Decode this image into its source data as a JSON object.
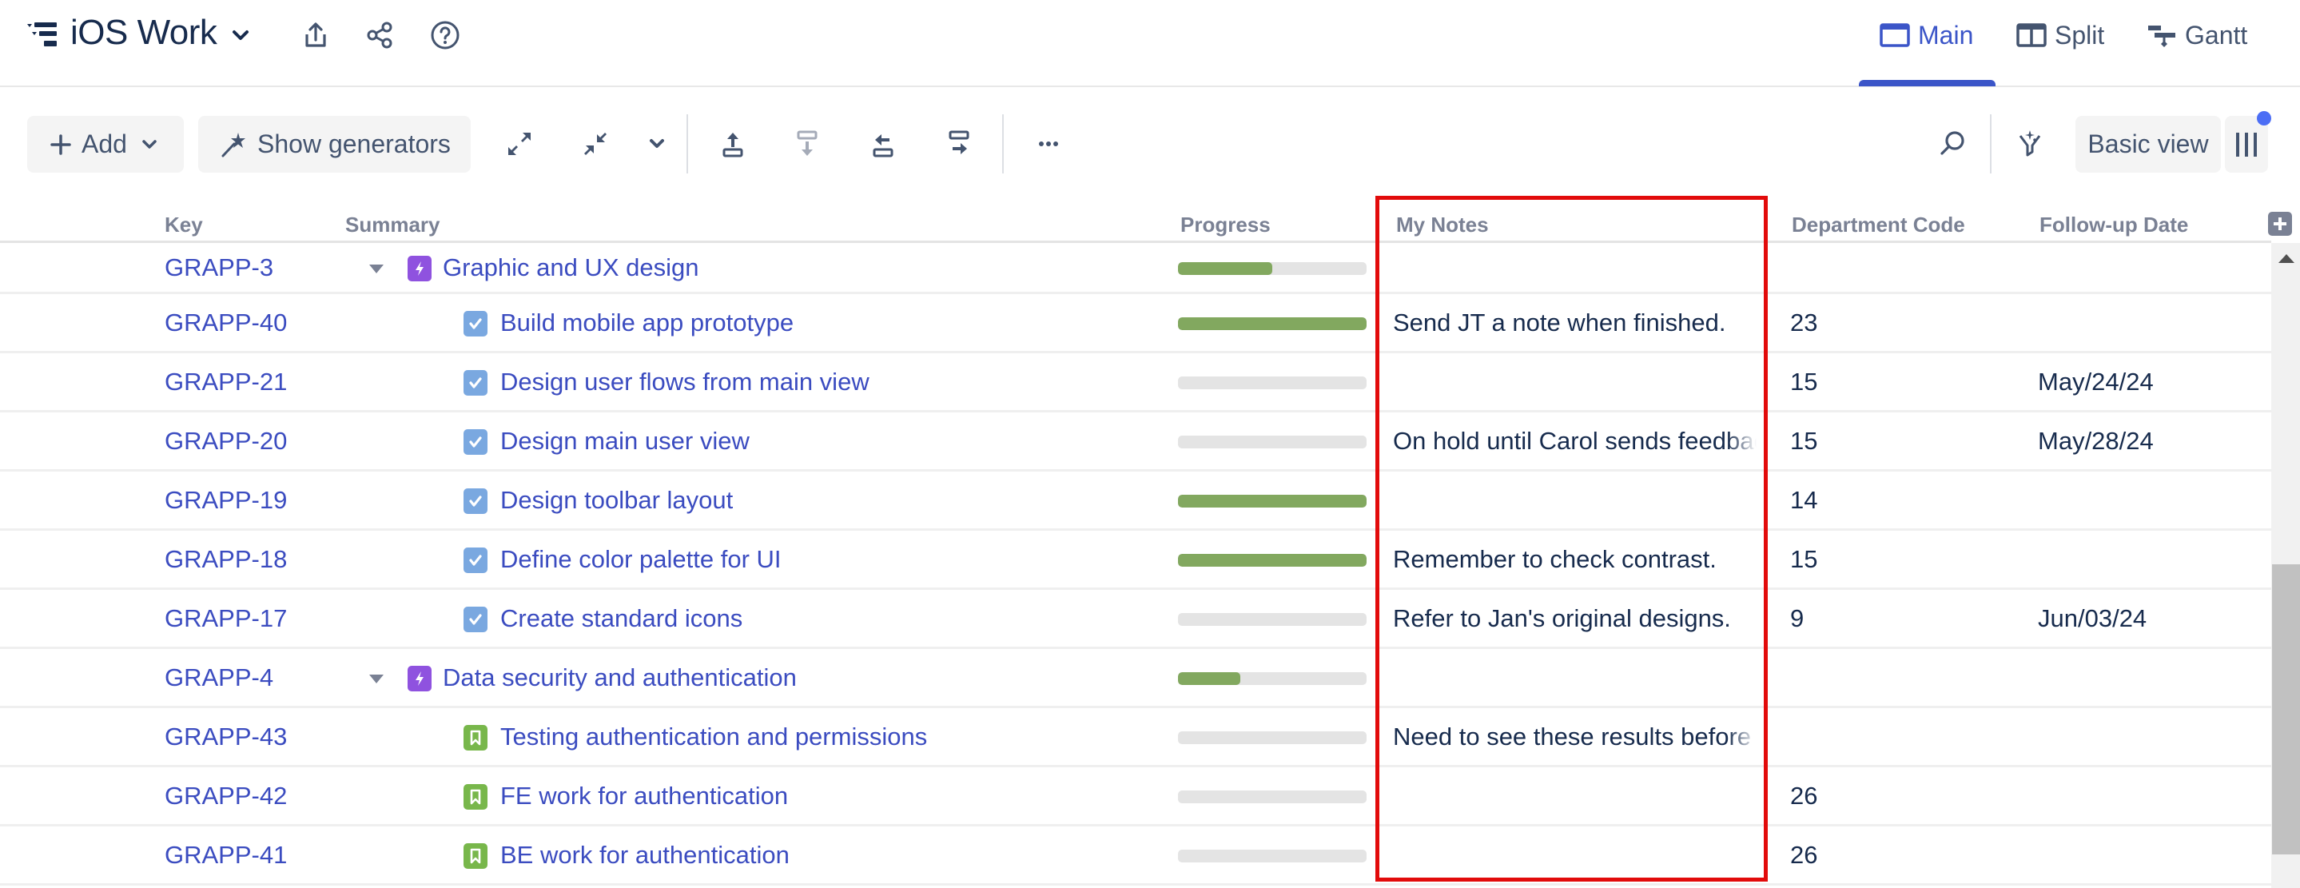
{
  "header": {
    "title": "iOS Work",
    "icons": [
      "structure-icon",
      "chevron-down-icon",
      "export-icon",
      "share-icon",
      "help-icon"
    ],
    "tabs": [
      {
        "label": "Main",
        "icon": "window-icon",
        "active": true
      },
      {
        "label": "Split",
        "icon": "split-view-icon",
        "active": false
      },
      {
        "label": "Gantt",
        "icon": "gantt-icon",
        "active": false
      }
    ],
    "accent_color": "#3b55c8"
  },
  "toolbar": {
    "add_label": "Add",
    "generators_label": "Show generators",
    "view_label": "Basic view",
    "icons": [
      "expand-icon",
      "collapse-icon",
      "chevron-down-icon",
      "move-up-icon",
      "move-down-icon",
      "outdent-icon",
      "indent-icon",
      "more-icon",
      "search-icon",
      "smart-filter-icon",
      "columns-icon"
    ],
    "notification_dot_color": "#4c6ef5"
  },
  "table": {
    "columns": [
      "Key",
      "Summary",
      "Progress",
      "My Notes",
      "Department Code",
      "Follow-up Date"
    ],
    "rows": [
      {
        "key": "GRAPP-3",
        "summary": "Graphic and UX design",
        "type": "epic",
        "level": 0,
        "expanded": true,
        "progress": 0.5,
        "notes": "",
        "dept": "",
        "followup": ""
      },
      {
        "key": "GRAPP-40",
        "summary": "Build mobile app prototype",
        "type": "task",
        "level": 1,
        "progress": 1.0,
        "notes": "Send JT a note when finished.",
        "dept": "23",
        "followup": ""
      },
      {
        "key": "GRAPP-21",
        "summary": "Design user flows from main view",
        "type": "task",
        "level": 1,
        "progress": 0.0,
        "notes": "",
        "dept": "15",
        "followup": "May/24/24"
      },
      {
        "key": "GRAPP-20",
        "summary": "Design main user view",
        "type": "task",
        "level": 1,
        "progress": 0.0,
        "notes": "On hold until Carol sends feedback",
        "dept": "15",
        "followup": "May/28/24"
      },
      {
        "key": "GRAPP-19",
        "summary": "Design toolbar layout",
        "type": "task",
        "level": 1,
        "progress": 1.0,
        "notes": "",
        "dept": "14",
        "followup": ""
      },
      {
        "key": "GRAPP-18",
        "summary": "Define color palette for UI",
        "type": "task",
        "level": 1,
        "progress": 1.0,
        "notes": "Remember to check contrast.",
        "dept": "15",
        "followup": ""
      },
      {
        "key": "GRAPP-17",
        "summary": "Create standard icons",
        "type": "task",
        "level": 1,
        "progress": 0.0,
        "notes": "Refer to Jan's original designs.",
        "dept": "9",
        "followup": "Jun/03/24"
      },
      {
        "key": "GRAPP-4",
        "summary": "Data security and authentication",
        "type": "epic",
        "level": 0,
        "expanded": true,
        "progress": 0.33,
        "notes": "",
        "dept": "",
        "followup": ""
      },
      {
        "key": "GRAPP-43",
        "summary": "Testing authentication and permissions",
        "type": "story",
        "level": 1,
        "progress": 0.0,
        "notes": "Need to see these results before f",
        "dept": "",
        "followup": ""
      },
      {
        "key": "GRAPP-42",
        "summary": "FE work for authentication",
        "type": "story",
        "level": 1,
        "progress": 0.0,
        "notes": "",
        "dept": "26",
        "followup": ""
      },
      {
        "key": "GRAPP-41",
        "summary": "BE work for authentication",
        "type": "story",
        "level": 1,
        "progress": 0.0,
        "notes": "",
        "dept": "26",
        "followup": ""
      }
    ],
    "highlighted_column": "My Notes",
    "highlight_color": "#e20b0b",
    "progress_color": "#82a85f",
    "type_colors": {
      "epic": "#8f52df",
      "task": "#7aa8e0",
      "story": "#78b74b"
    }
  }
}
